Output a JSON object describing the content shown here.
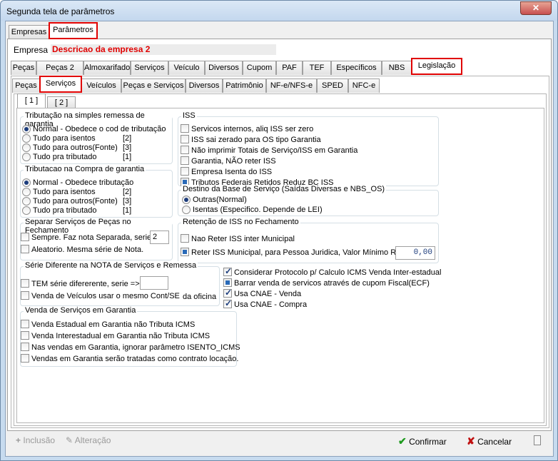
{
  "window": {
    "title": "Segunda tela de parâmetros",
    "close_label": "✕"
  },
  "top_tabs": [
    "Empresas",
    "Parâmetros"
  ],
  "company": {
    "label": "Empresa",
    "value": "Descricao da empresa 2"
  },
  "param_tabs": [
    "Peças",
    "Peças 2",
    "Almoxarifado",
    "Serviços",
    "Veículo",
    "Diversos",
    "Cupom",
    "PAF",
    "TEF",
    "Específicos",
    "NBS",
    "Legislação"
  ],
  "leg_tabs": [
    "Peças",
    "Serviços",
    "Veículos",
    "Peças e Serviços",
    "Diversos",
    "Patrimônio",
    "NF-e/NFS-e",
    "SPED",
    "NFC-e"
  ],
  "page_tabs": [
    "[ 1 ]",
    "[ 2 ]"
  ],
  "trib_simples": {
    "title": "Tributação na simples remessa de garantia",
    "options": [
      {
        "label": "Normal - Obedece o cod de tributação",
        "code": ""
      },
      {
        "label": "Tudo para isentos",
        "code": "[2]"
      },
      {
        "label": "Tudo para outros(Fonte)",
        "code": "[3]"
      },
      {
        "label": "Tudo pra tributado",
        "code": "[1]"
      }
    ]
  },
  "trib_compra": {
    "title": "Tributacao na Compra de garantia",
    "options": [
      {
        "label": "Normal - Obedece tributação",
        "code": ""
      },
      {
        "label": "Tudo para isentos",
        "code": "[2]"
      },
      {
        "label": "Tudo para outros(Fonte)",
        "code": "[3]"
      },
      {
        "label": "Tudo pra tributado",
        "code": "[1]"
      }
    ]
  },
  "iss": {
    "title": "ISS",
    "items": [
      "Servicos internos, aliq ISS ser zero",
      "ISS sai zerado para OS tipo Garantia",
      "Não imprimir Totais de Serviço/ISS em Garantia",
      "Garantia, NÃO reter ISS",
      "Empresa Isenta do ISS",
      "Tributos Federais Retidos Reduz BC ISS"
    ]
  },
  "destino": {
    "title": "Destino da Base de Serviço (Saídas Diversas e NBS_OS)",
    "options": [
      "Outras(Normal)",
      "Isentas (Especifico. Depende de LEI)"
    ]
  },
  "separar": {
    "title": "Separar Serviços de Peças no Fechamento",
    "opt1": "Sempre. Faz nota Separada, serie:",
    "serie": "2",
    "opt2": "Aleatorio. Mesma série de Nota."
  },
  "retencao": {
    "title": "Retenção de ISS no Fechamento",
    "opt1": "Nao Reter ISS inter Municipal",
    "opt2": "Reter ISS Municipal, para Pessoa Juridica, Valor Mínimo R$",
    "valor": "0,00"
  },
  "serie_dif": {
    "title": "Série Diferente na NOTA de Serviços e Remessa",
    "opt1": "TEM série difererente, serie =>",
    "serie": "",
    "opt2": "Venda de Veículos usar o mesmo Cont/SE",
    "opt2_suffix": "da oficina"
  },
  "extras": [
    "Considerar Protocolo p/ Calculo ICMS Venda Inter-estadual",
    "Barrar venda de servicos através de cupom Fiscal(ECF)",
    "Usa CNAE - Venda",
    "Usa CNAE - Compra"
  ],
  "venda_garantia": {
    "title": "Venda de Serviços em Garantia",
    "items": [
      "Venda Estadual em Garantia não Tributa ICMS",
      "Venda Interestadual em Garantia não Tributa ICMS",
      "Nas vendas em Garantia, ignorar parâmetro ISENTO_ICMS",
      "Vendas em Garantia serão tratadas como contrato locação."
    ]
  },
  "footer": {
    "inclusao": "Inclusão",
    "alteracao": "Alteração",
    "confirmar": "Confirmar",
    "cancelar": "Cancelar"
  },
  "colors": {
    "accent": "#e00000",
    "company_name": "#e00000"
  }
}
